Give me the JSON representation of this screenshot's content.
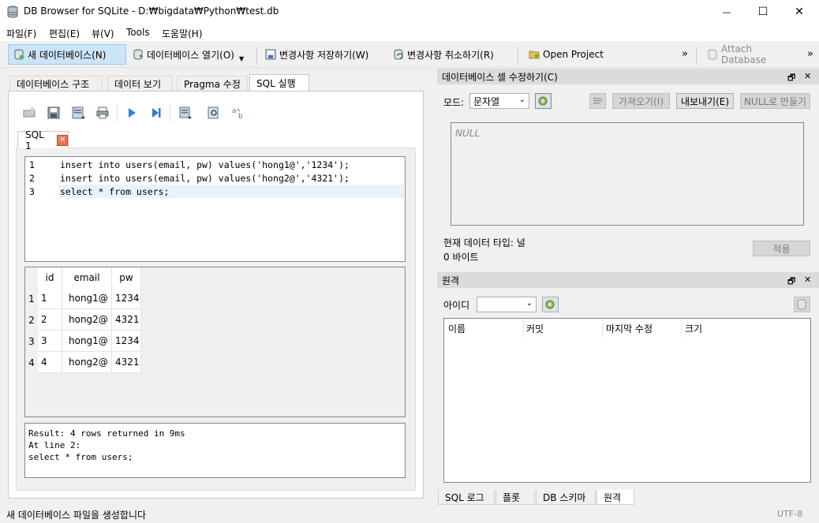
{
  "window": {
    "title": "DB Browser for SQLite - D:₩bigdata₩Python₩test.db",
    "minimize": "—",
    "maximize": "☐",
    "close": "✕"
  },
  "menu": [
    "파일(F)",
    "편집(E)",
    "뷰(V)",
    "Tools",
    "도움말(H)"
  ],
  "toolbar": {
    "new_db": "새 데이터베이스(N)",
    "open_db": "데이터베이스 열기(O)",
    "write_changes": "변경사항 저장하기(W)",
    "revert_changes": "변경사항 취소하기(R)",
    "open_project": "Open Project",
    "attach_db": "Attach Database",
    "more": "»"
  },
  "left_tabs": [
    "데이터베이스 구조",
    "데이터 보기",
    "Pragma 수정",
    "SQL 실행"
  ],
  "sql_tab": {
    "label": "SQL 1",
    "close": "✕"
  },
  "editor": {
    "line_numbers": [
      "1",
      "2",
      "3"
    ],
    "lines": [
      "insert into users(email, pw) values('hong1@','1234');",
      "insert into users(email, pw) values('hong2@','4321');",
      "select * from users;"
    ]
  },
  "results": {
    "columns": [
      "id",
      "email",
      "pw"
    ],
    "row_headers": [
      "1",
      "2",
      "3",
      "4"
    ],
    "rows": [
      [
        "1",
        "hong1@",
        "1234"
      ],
      [
        "2",
        "hong2@",
        "4321"
      ],
      [
        "3",
        "hong1@",
        "1234"
      ],
      [
        "4",
        "hong2@",
        "4321"
      ]
    ]
  },
  "messages": [
    "Result: 4 rows returned in 9ms",
    "At line 2:",
    "select * from users;"
  ],
  "edit_cell": {
    "title": "데이터베이스 셀 수정하기(C)",
    "mode_label": "모드:",
    "mode_value": "문자열",
    "import_label": "가져오기(I)",
    "export_label": "내보내기(E)",
    "set_null_label": "NULL로 만들기",
    "editor_text": "NULL",
    "type_text": "현재 데이터 타입: 널",
    "size_text": "0 바이트",
    "apply_label": "적용"
  },
  "remote": {
    "title": "원격",
    "identity_label": "아이디",
    "columns": [
      "이름",
      "커밋",
      "마지막 수정",
      "크기"
    ]
  },
  "bottom_tabs": [
    "SQL 로그",
    "플롯",
    "DB 스키마",
    "원격"
  ],
  "status": {
    "text": "새 데이터베이스 파일을 생성합니다",
    "encoding": "UTF-8"
  },
  "dock_buttons": {
    "float": "🗗",
    "close": "✕"
  },
  "colors": {
    "accent": "#cce4f7",
    "keyword": "#00008b",
    "table": "#008080",
    "field": "#8b008b",
    "string": "#a52a2a"
  }
}
